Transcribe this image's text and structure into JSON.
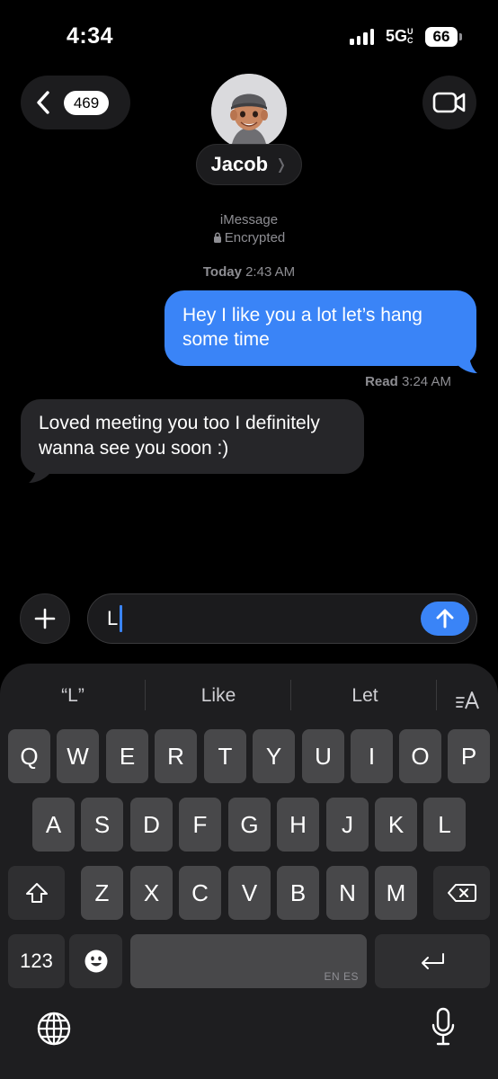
{
  "status_bar": {
    "time": "4:34",
    "network": "5G",
    "network_suffix": "UC",
    "battery": "66"
  },
  "header": {
    "back_badge": "469",
    "contact_name": "Jacob",
    "icons": [
      "chevron-left-icon",
      "video-camera-icon",
      "memoji-avatar"
    ]
  },
  "conversation": {
    "service": "iMessage",
    "encrypted": "Encrypted",
    "timestamp_day": "Today",
    "timestamp_time": "2:43 AM",
    "messages": [
      {
        "direction": "outgoing",
        "text": "Hey I like you a lot let’s hang some time"
      },
      {
        "direction": "incoming",
        "text": "Loved meeting you too I definitely wanna see you soon :)"
      }
    ],
    "read_label": "Read",
    "read_time": "3:24 AM"
  },
  "compose": {
    "value": "L"
  },
  "keyboard": {
    "suggestions": [
      "“L”",
      "Like",
      "Let"
    ],
    "row1": [
      "Q",
      "W",
      "E",
      "R",
      "T",
      "Y",
      "U",
      "I",
      "O",
      "P"
    ],
    "row2": [
      "A",
      "S",
      "D",
      "F",
      "G",
      "H",
      "J",
      "K",
      "L"
    ],
    "row3": [
      "Z",
      "X",
      "C",
      "V",
      "B",
      "N",
      "M"
    ],
    "numbers_key": "123",
    "languages": "EN ES"
  },
  "colors": {
    "accent": "#3a84f7",
    "bubble_in": "#262629",
    "background": "#000000"
  }
}
